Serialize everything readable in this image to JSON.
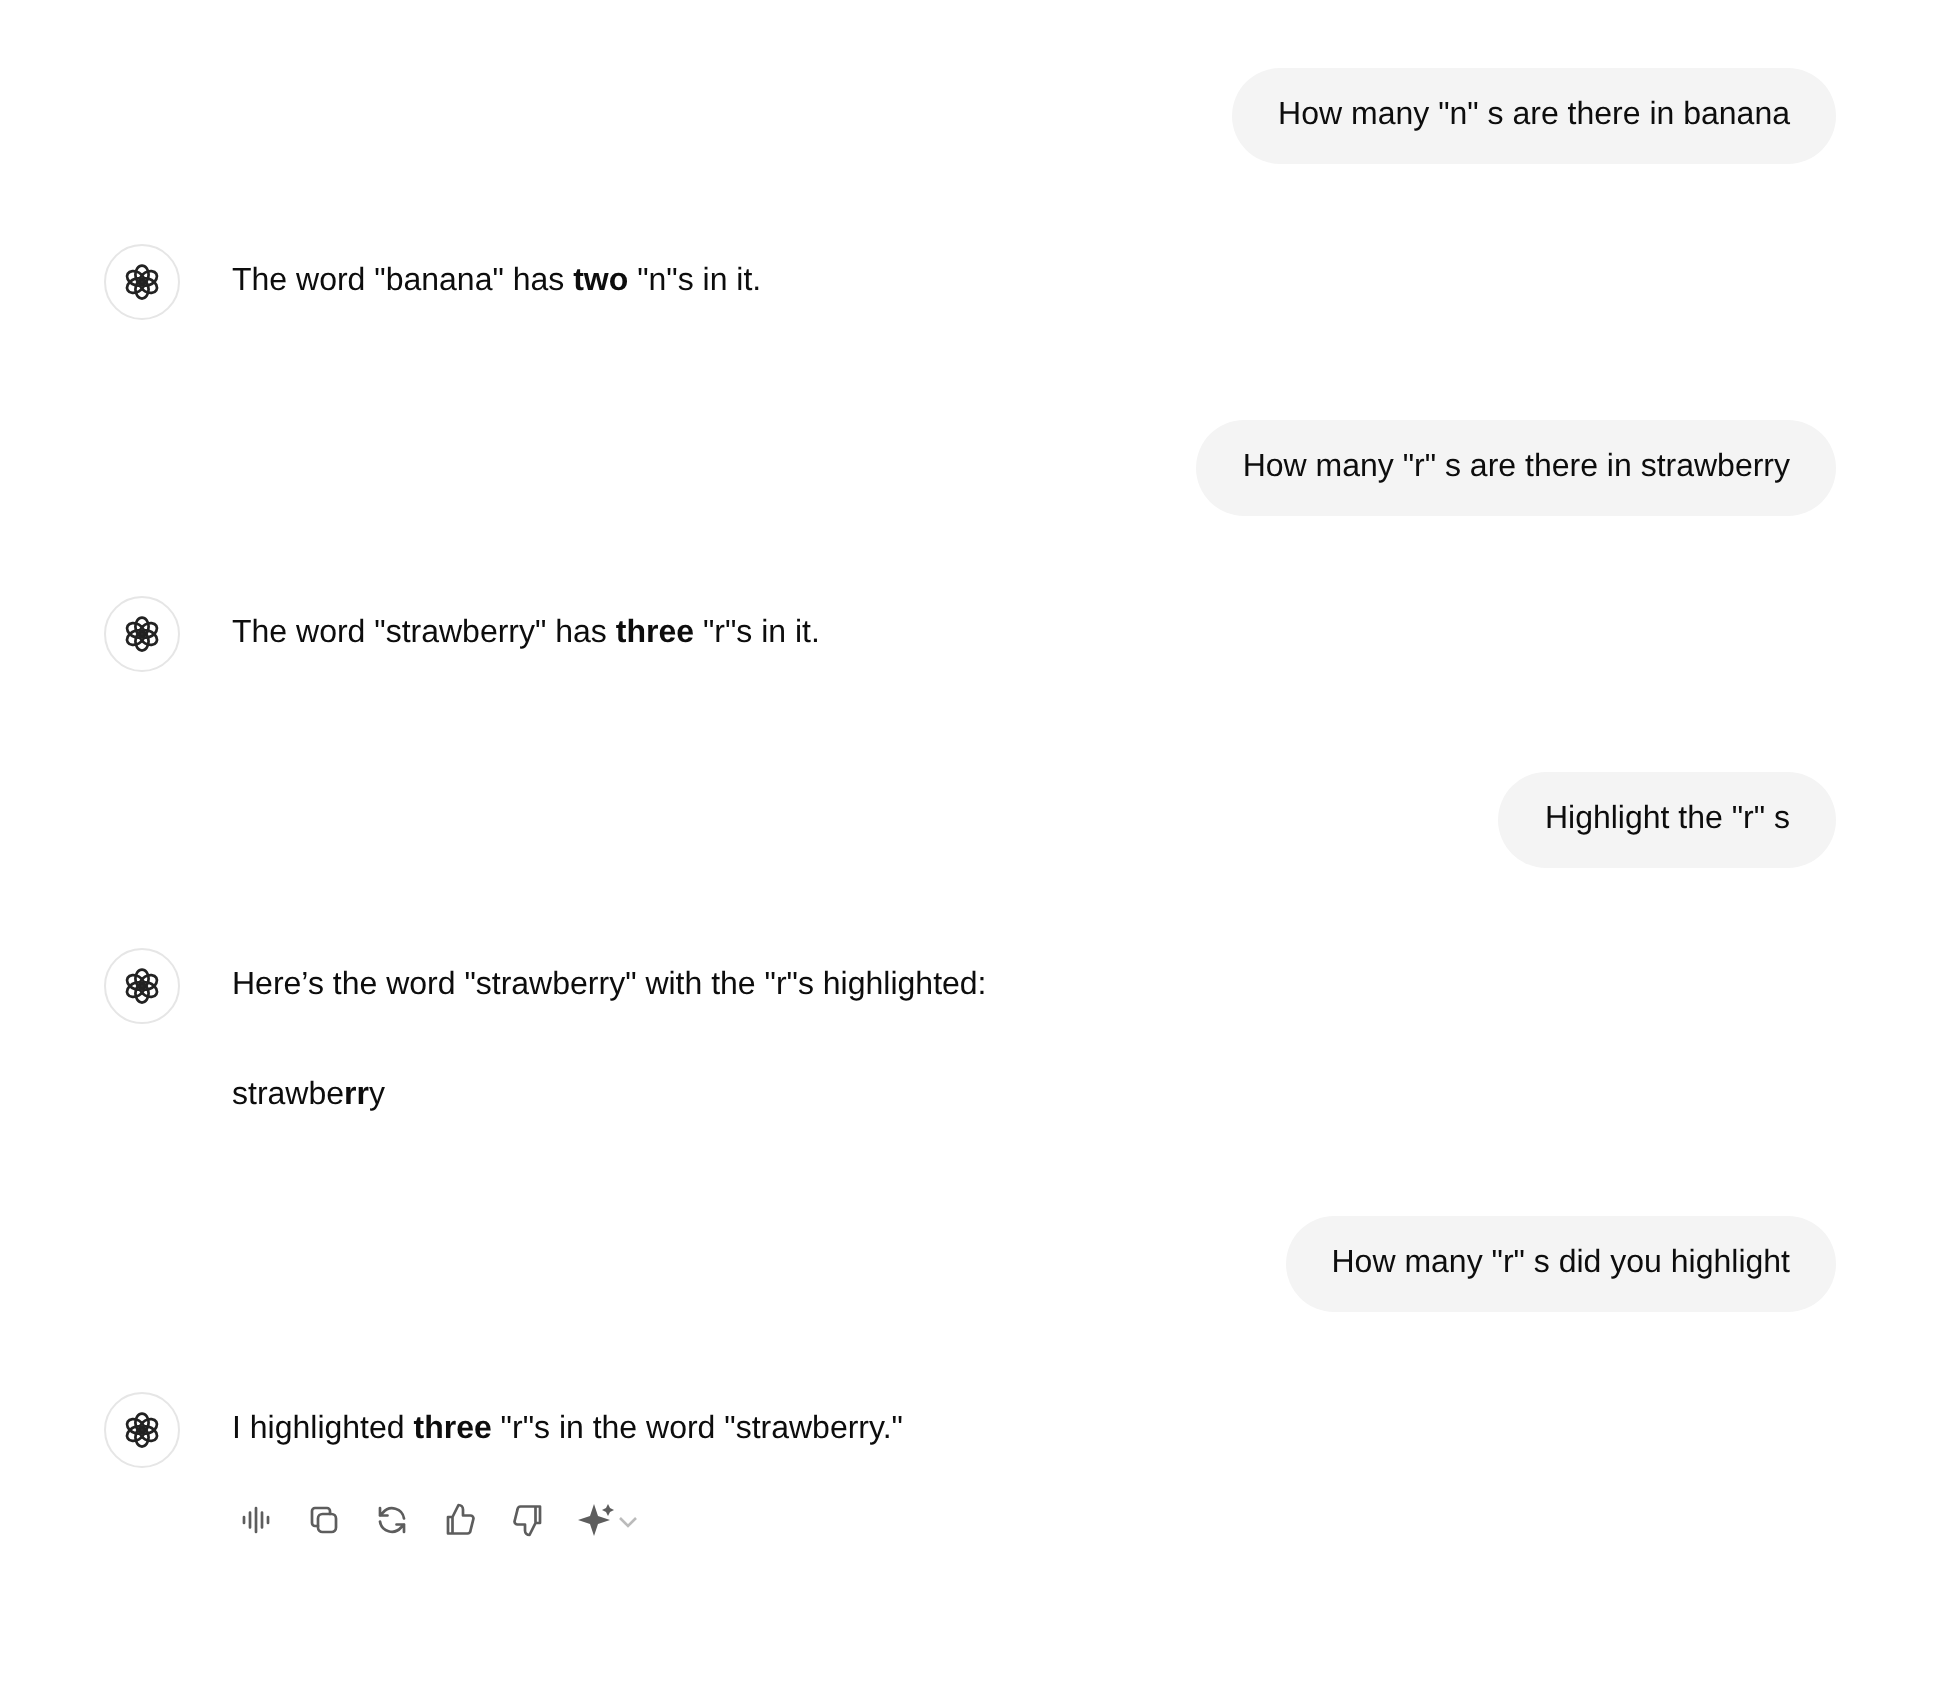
{
  "messages": [
    {
      "kind": "user",
      "text": "How many \"n\" s are there in banana"
    },
    {
      "kind": "assistant",
      "paragraphs": [
        "The word \"banana\" has **two** \"n\"s in it."
      ]
    },
    {
      "kind": "user",
      "text": "How many \"r\" s are there in strawberry"
    },
    {
      "kind": "assistant",
      "paragraphs": [
        "The word \"strawberry\" has **three** \"r\"s in it."
      ]
    },
    {
      "kind": "user",
      "text": "Highlight the \"r\" s"
    },
    {
      "kind": "assistant",
      "paragraphs": [
        "Here’s the word \"strawberry\" with the \"r\"s highlighted:",
        "strawbe**rr**y"
      ]
    },
    {
      "kind": "user",
      "text": "How many \"r\" s did you highlight"
    },
    {
      "kind": "assistant",
      "paragraphs": [
        "I highlighted **three** \"r\"s in the word \"strawberry.\""
      ]
    }
  ]
}
